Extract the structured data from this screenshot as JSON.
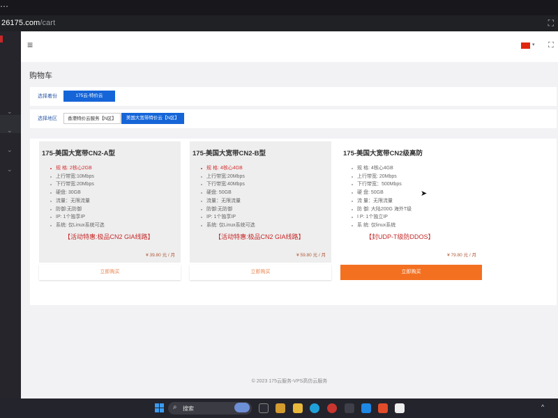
{
  "browser": {
    "url_host": "26175.com",
    "url_path": "/cart"
  },
  "page": {
    "title": "购物车",
    "footer": "© 2023 175云服务-VPS高仿云服务"
  },
  "filters": {
    "group_label": "选择着份",
    "group_option": "175云-特价云",
    "region_label": "选择地区",
    "region_options": [
      "香港特价云服务【N区】",
      "美国大宽带特价云【N区】"
    ]
  },
  "products": [
    {
      "title": "175-美国大宽带CN2-A型",
      "specs": [
        "规 格: 2核心2GB",
        "上行带宽:10Mbps",
        "下行带宽:20Mbps",
        "硬盘: 30GB",
        "流量：无限流量",
        "防御:无防御",
        "IP: 1个独享IP",
        "系统: 仅Linux系统可选"
      ],
      "promo": "【活动特惠:极品CN2 GIA线路】",
      "price": "¥ 39.80 元 / 月",
      "buy_label": "立即购买"
    },
    {
      "title": "175-美国大宽带CN2-B型",
      "specs": [
        "规 格: 4核心4GB",
        "上行带宽:20Mbps",
        "下行带宽:40Mbps",
        "硬盘: 50GB",
        "流量：无限流量",
        "防御:无防御",
        "IP: 1个独享IP",
        "系统: 仅Linux系统可选"
      ],
      "promo": "【活动特惠:极品CN2 GIA线路】",
      "price": "¥ 59.80 元 / 月",
      "buy_label": "立即购买"
    },
    {
      "title": "175-美国大宽带CN2级高防",
      "specs": [
        "规 格: 4核心4GB",
        "上行带宽: 20Mbps",
        "下行带宽：500Mbps",
        "硬 盘: 50GB",
        "流 量：无限流量",
        "防 御: 大陆200G 海外T级",
        "I P: 1个独立IP",
        "系 统: 仅linux系统"
      ],
      "promo": "【封UDP-T级防DDOS】",
      "price": "¥ 79.80 元 / 月",
      "buy_label": "立即购买"
    }
  ],
  "taskbar": {
    "search_text": "搜索"
  },
  "icons": {
    "menu": "hamburger-icon",
    "language": "china-flag-icon",
    "fullscreen": "fullscreen-icon",
    "search": "search-icon"
  },
  "colors": {
    "accent_blue": "#1565d8",
    "buy_orange": "#f37021",
    "spec_red": "#d32f2f"
  }
}
